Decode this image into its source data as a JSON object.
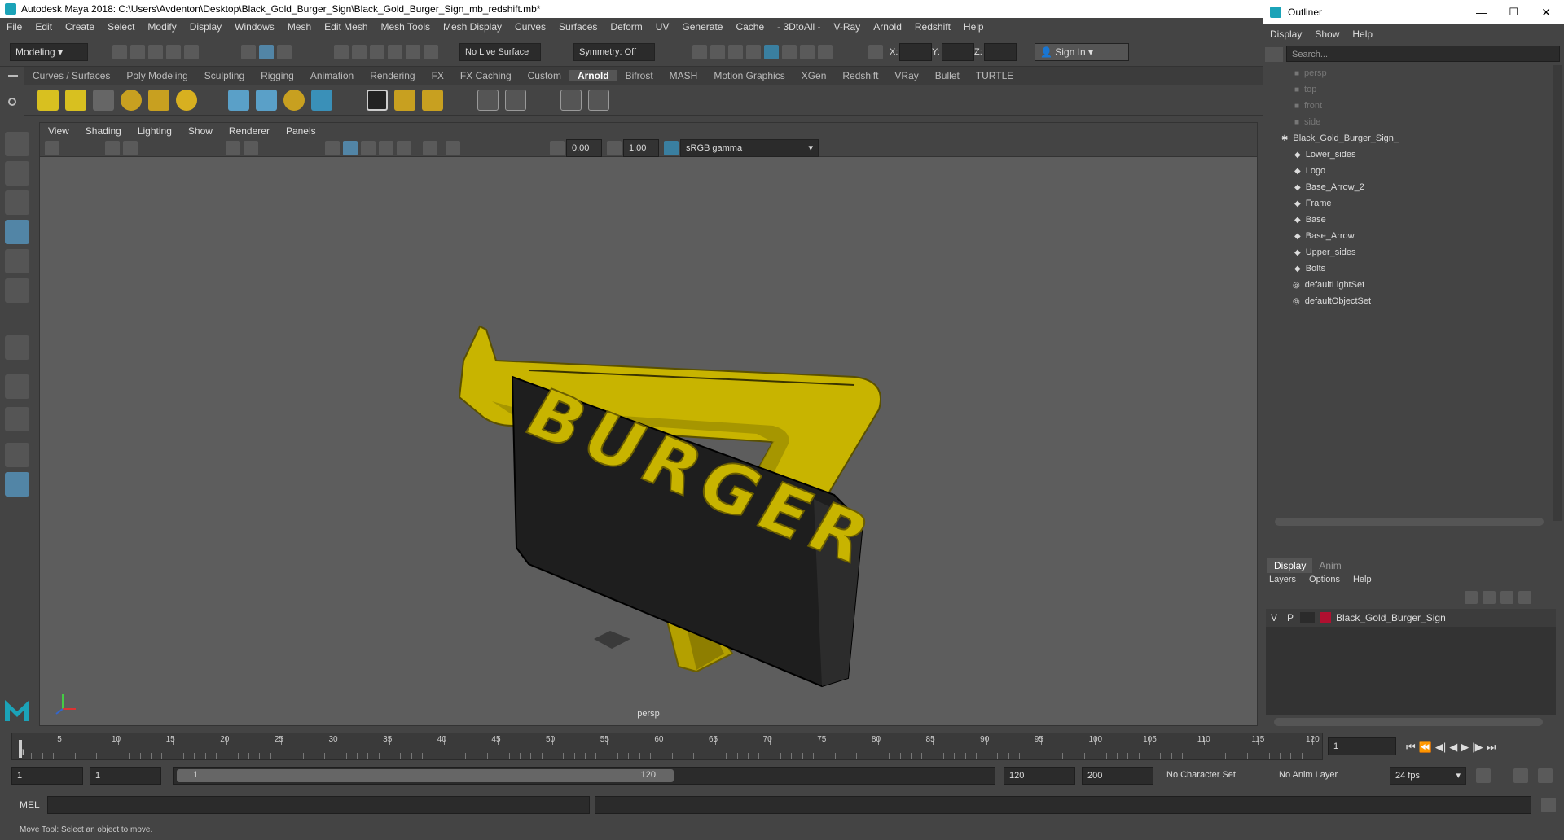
{
  "window": {
    "title": "Autodesk Maya 2018: C:\\Users\\Avdenton\\Desktop\\Black_Gold_Burger_Sign\\Black_Gold_Burger_Sign_mb_redshift.mb*"
  },
  "menu": [
    "File",
    "Edit",
    "Create",
    "Select",
    "Modify",
    "Display",
    "Windows",
    "Mesh",
    "Edit Mesh",
    "Mesh Tools",
    "Mesh Display",
    "Curves",
    "Surfaces",
    "Deform",
    "UV",
    "Generate",
    "Cache",
    "- 3DtoAll -",
    "V-Ray",
    "Arnold",
    "Redshift",
    "Help"
  ],
  "status": {
    "mode": "Modeling",
    "live_surface": "No Live Surface",
    "symmetry": "Symmetry: Off",
    "x_label": "X:",
    "y_label": "Y:",
    "z_label": "Z:",
    "sign_in": "Sign In"
  },
  "shelf_tabs": [
    "Curves / Surfaces",
    "Poly Modeling",
    "Sculpting",
    "Rigging",
    "Animation",
    "Rendering",
    "FX",
    "FX Caching",
    "Custom",
    "Arnold",
    "Bifrost",
    "MASH",
    "Motion Graphics",
    "XGen",
    "Redshift",
    "VRay",
    "Bullet",
    "TURTLE"
  ],
  "active_shelf": "Arnold",
  "viewport": {
    "menu": [
      "View",
      "Shading",
      "Lighting",
      "Show",
      "Renderer",
      "Panels"
    ],
    "exposure": "0.00",
    "gamma": "1.00",
    "color_space": "sRGB gamma",
    "camera": "persp",
    "sign_text": "BURGER"
  },
  "outliner": {
    "title": "Outliner",
    "menu": [
      "Display",
      "Show",
      "Help"
    ],
    "search_placeholder": "Search...",
    "cameras": [
      "persp",
      "top",
      "front",
      "side"
    ],
    "group": "Black_Gold_Burger_Sign_",
    "children": [
      "Lower_sides",
      "Logo",
      "Base_Arrow_2",
      "Frame",
      "Base",
      "Base_Arrow",
      "Upper_sides",
      "Bolts"
    ],
    "sets": [
      "defaultLightSet",
      "defaultObjectSet"
    ]
  },
  "layers": {
    "tabs": [
      "Display",
      "Anim"
    ],
    "menu": [
      "Layers",
      "Options",
      "Help"
    ],
    "row": {
      "v": "V",
      "p": "P",
      "name": "Black_Gold_Burger_Sign",
      "color": "#b01030"
    }
  },
  "timeline": {
    "ticks": [
      "5",
      "10",
      "15",
      "20",
      "25",
      "30",
      "35",
      "40",
      "45",
      "50",
      "55",
      "60",
      "65",
      "70",
      "75",
      "80",
      "85",
      "90",
      "95",
      "100",
      "105",
      "110",
      "115",
      "120"
    ],
    "first": "1",
    "current": "1"
  },
  "range": {
    "start": "1",
    "playback_start": "1",
    "slider_start": "1",
    "slider_end": "120",
    "playback_end": "120",
    "end": "200",
    "character_set": "No Character Set",
    "anim_layer": "No Anim Layer",
    "fps": "24 fps"
  },
  "mel": {
    "label": "MEL"
  },
  "help_line": "Move Tool: Select an object to move.",
  "colors": {
    "gold": "#c8b400",
    "sign_black": "#1e1e1e",
    "accent": "#5285a6"
  }
}
